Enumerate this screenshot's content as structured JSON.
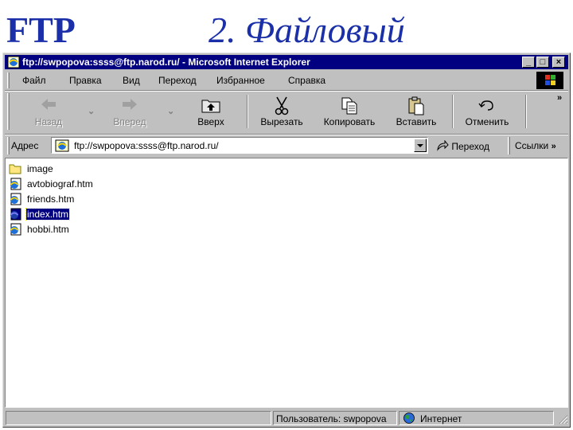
{
  "slide": {
    "title_left": "FTP",
    "title_right": "2. Файловый"
  },
  "window": {
    "title": "ftp://swpopova:ssss@ftp.narod.ru/ - Microsoft Internet Explorer",
    "minimize": "_",
    "maximize": "□",
    "close": "×"
  },
  "menu": [
    "Файл",
    "Правка",
    "Вид",
    "Переход",
    "Избранное",
    "Справка"
  ],
  "toolbar": {
    "back": "Назад",
    "forward": "Вперед",
    "up": "Вверх",
    "cut": "Вырезать",
    "copy": "Копировать",
    "paste": "Вставить",
    "undo": "Отменить",
    "more": "»"
  },
  "address": {
    "label": "Адрес",
    "url": "ftp://swpopova:ssss@ftp.narod.ru/",
    "go": "Переход",
    "links": "Ссылки",
    "links_more": "»"
  },
  "files": [
    {
      "name": "image",
      "type": "folder",
      "selected": false
    },
    {
      "name": "avtobiograf.htm",
      "type": "htm",
      "selected": false
    },
    {
      "name": "friends.htm",
      "type": "htm",
      "selected": false
    },
    {
      "name": "index.htm",
      "type": "htm",
      "selected": true
    },
    {
      "name": "hobbi.htm",
      "type": "htm",
      "selected": false
    }
  ],
  "status": {
    "user": "Пользователь: swpopova",
    "zone": "Интернет"
  },
  "colors": {
    "titlebar": "#000080",
    "face": "#c0c0c0",
    "slide_title": "#1a2fa8",
    "selection": "#000080"
  }
}
